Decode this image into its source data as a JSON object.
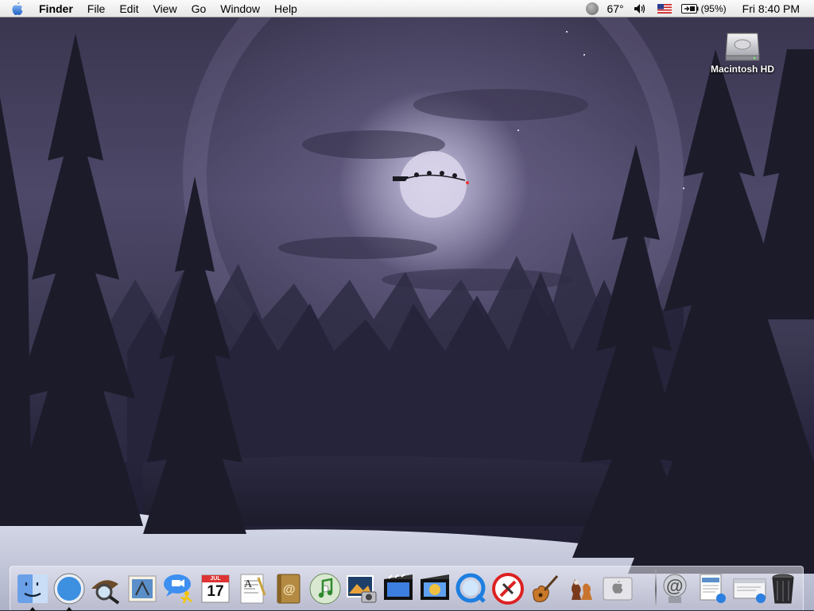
{
  "menubar": {
    "app_name": "Finder",
    "menus": [
      "File",
      "Edit",
      "View",
      "Go",
      "Window",
      "Help"
    ],
    "status": {
      "temperature": "67°",
      "battery": "(95%)",
      "clock": "Fri 8:40 PM"
    }
  },
  "desktop": {
    "icons": [
      {
        "label": "Macintosh HD",
        "icon": "hard-drive-icon"
      }
    ]
  },
  "dock": {
    "apps": [
      {
        "name": "Finder",
        "icon": "finder-icon",
        "running": true
      },
      {
        "name": "Safari",
        "icon": "safari-icon",
        "running": true
      },
      {
        "name": "Sherlock",
        "icon": "sherlock-icon",
        "running": false
      },
      {
        "name": "Mail",
        "icon": "mail-icon",
        "running": false
      },
      {
        "name": "iChat",
        "icon": "ichat-icon",
        "running": false
      },
      {
        "name": "iCal",
        "icon": "ical-icon",
        "running": false,
        "badge_month": "JUL",
        "badge_day": "17"
      },
      {
        "name": "TextEdit",
        "icon": "textedit-icon",
        "running": false
      },
      {
        "name": "Address Book",
        "icon": "address-book-icon",
        "running": false
      },
      {
        "name": "iTunes",
        "icon": "itunes-icon",
        "running": false
      },
      {
        "name": "iPhoto",
        "icon": "iphoto-icon",
        "running": false
      },
      {
        "name": "iMovie",
        "icon": "imovie-icon",
        "running": false
      },
      {
        "name": "iDVD",
        "icon": "idvd-icon",
        "running": false
      },
      {
        "name": "QuickTime Player",
        "icon": "quicktime-icon",
        "running": false
      },
      {
        "name": "No Entry App",
        "icon": "no-entry-icon",
        "running": false
      },
      {
        "name": "GarageBand",
        "icon": "garageband-icon",
        "running": false
      },
      {
        "name": "Chess",
        "icon": "chess-icon",
        "running": false
      },
      {
        "name": "Apple",
        "icon": "apple-app-icon",
        "running": false
      }
    ],
    "docs": [
      {
        "name": "Mail Link",
        "icon": "at-sign-icon"
      },
      {
        "name": "Document Stack",
        "icon": "documents-icon",
        "partial_text": "gif"
      },
      {
        "name": "Window Preview",
        "icon": "window-preview-icon"
      },
      {
        "name": "Trash",
        "icon": "trash-icon"
      }
    ]
  },
  "colors": {
    "menubar_top": "#fafafa",
    "menubar_bottom": "#e6e6e6",
    "sky": "#4d4868",
    "moon": "#dcd7eb",
    "snow": "#d8dcea"
  }
}
